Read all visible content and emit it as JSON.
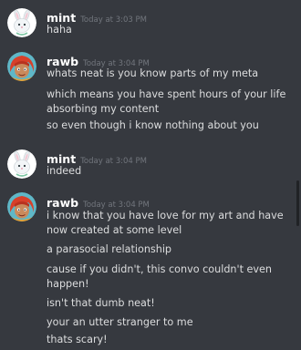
{
  "messages": [
    {
      "author": "mint",
      "timestamp": "Today at 3:03 PM",
      "avatar_icon": "bunny-avatar-icon",
      "lines": [
        "haha"
      ]
    },
    {
      "author": "rawb",
      "timestamp": "Today at 3:04 PM",
      "avatar_icon": "red-haired-character-avatar-icon",
      "lines": [
        "whats neat is you know parts of my meta",
        "which means you have spent hours of your life absorbing my content",
        "so even though i know nothing about you"
      ]
    },
    {
      "author": "mint",
      "timestamp": "Today at 3:04 PM",
      "avatar_icon": "bunny-avatar-icon",
      "lines": [
        "indeed"
      ]
    },
    {
      "author": "rawb",
      "timestamp": "Today at 3:04 PM",
      "avatar_icon": "red-haired-character-avatar-icon",
      "lines": [
        "i know that you have love for my art and have now created at some level",
        "a parasocial relationship",
        "cause if you didn't, this convo couldn't even happen!",
        "isn't that dumb neat!",
        "your an utter stranger to me",
        "thats scary!"
      ]
    }
  ],
  "colors": {
    "background": "#36393f",
    "author": "#ffffff",
    "timestamp": "#72767d",
    "message_text": "#dcddde"
  }
}
